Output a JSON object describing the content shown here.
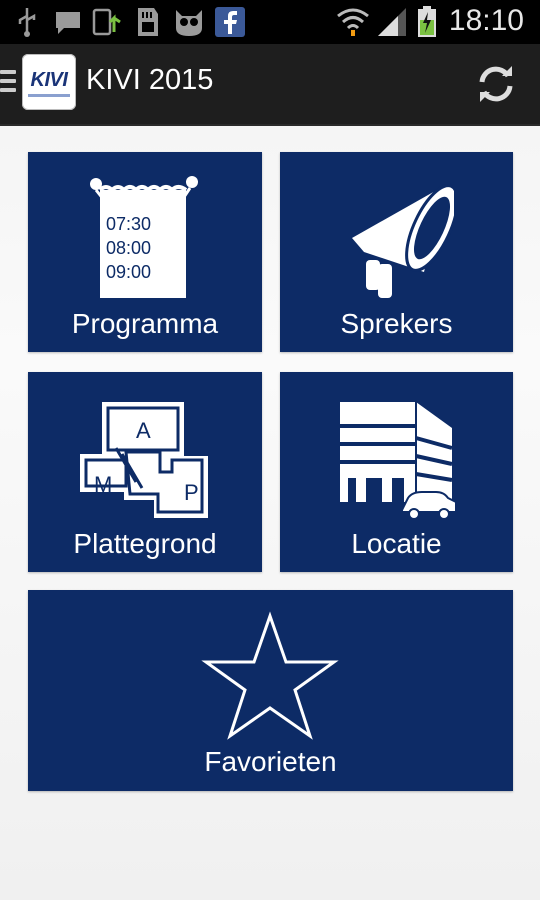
{
  "status_bar": {
    "time": "18:10",
    "icons": [
      "usb-icon",
      "chat-icon",
      "update-icon",
      "sd-card-icon",
      "owl-icon",
      "facebook-icon",
      "wifi-icon",
      "signal-icon",
      "battery-icon"
    ]
  },
  "action_bar": {
    "logo_text": "KIVI",
    "title": "KIVI 2015",
    "refresh_icon": "refresh-icon"
  },
  "tiles": {
    "programma": {
      "label": "Programma",
      "times": [
        "07:30",
        "08:00",
        "09:00"
      ]
    },
    "sprekers": {
      "label": "Sprekers"
    },
    "plattegrond": {
      "label": "Plattegrond",
      "rooms": [
        "A",
        "M",
        "P"
      ]
    },
    "locatie": {
      "label": "Locatie"
    },
    "favorieten": {
      "label": "Favorieten"
    }
  },
  "colors": {
    "tile_bg": "#0d2b66",
    "action_bar": "#1e1e1e",
    "status_bar": "#000000"
  }
}
